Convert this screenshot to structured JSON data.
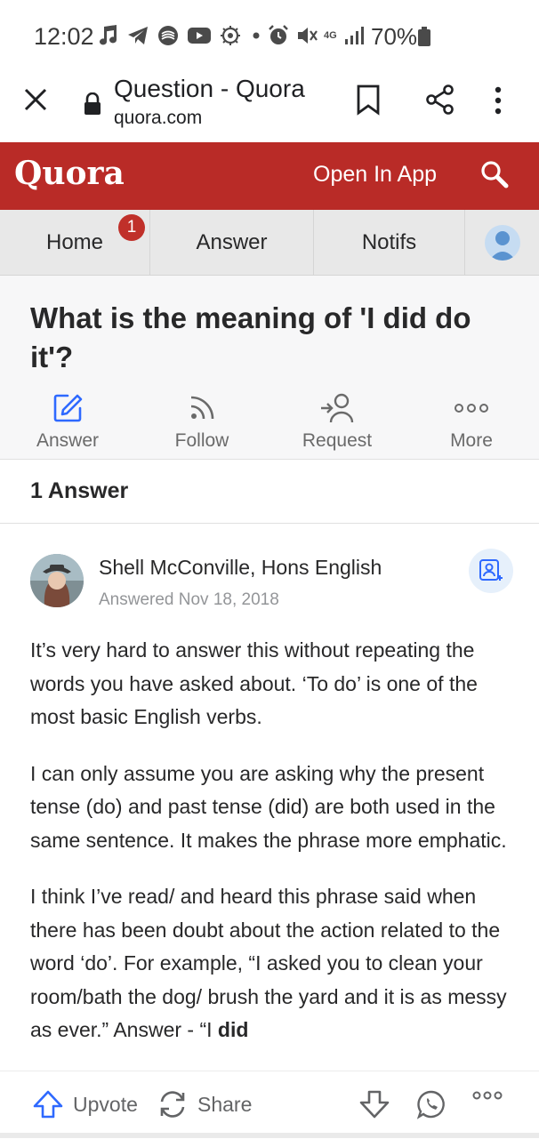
{
  "status_bar": {
    "time": "12:02",
    "network": "4G",
    "battery": "70%"
  },
  "browser": {
    "page_title": "Question - Quora",
    "url": "quora.com",
    "icons": [
      "close-icon",
      "lock-icon",
      "bookmark-icon",
      "share-icon",
      "more-vertical-icon"
    ]
  },
  "header": {
    "logo": "Quora",
    "open_in_app": "Open In App",
    "brand_color": "#b92b27"
  },
  "nav": {
    "tabs": [
      {
        "label": "Home",
        "badge": "1"
      },
      {
        "label": "Answer"
      },
      {
        "label": "Notifs"
      }
    ]
  },
  "question": {
    "title": "What is the meaning of 'I did do it'?",
    "actions": [
      {
        "label": "Answer",
        "icon": "edit-icon"
      },
      {
        "label": "Follow",
        "icon": "rss-icon"
      },
      {
        "label": "Request",
        "icon": "request-user-icon"
      },
      {
        "label": "More",
        "icon": "more-horizontal-icon"
      }
    ]
  },
  "answers_count": "1 Answer",
  "answer": {
    "author": "Shell McConville, Hons English",
    "date": "Answered Nov 18, 2018",
    "paragraphs": [
      "It’s very hard to answer this without repeating the words you have asked about. ‘To do’ is one of the most basic English verbs.",
      "I can only assume you are asking why the present tense (do) and past tense (did) are both used in the same sentence. It makes the phrase more emphatic.",
      "I think I’ve read/ and heard this phrase said when there has been doubt about the action related to the word ‘do’. For example, “I asked you to clean your room/bath the dog/ brush the yard and it is as messy as ever.” Answer - “I "
    ],
    "paragraph3_bold_end": "did"
  },
  "bottom_bar": {
    "upvote": "Upvote",
    "share": "Share"
  }
}
